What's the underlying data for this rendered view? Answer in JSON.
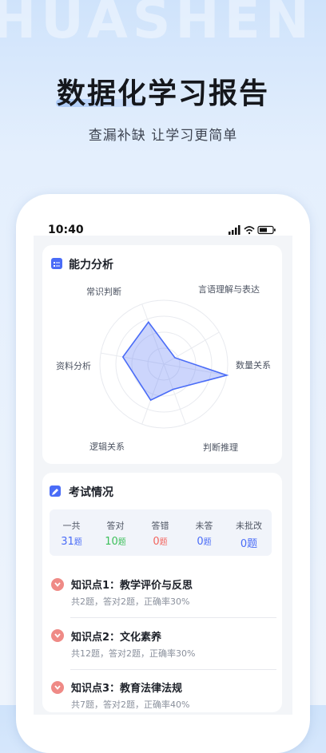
{
  "hero": {
    "bg_word": "HUASHEN",
    "title": "数据化学习报告",
    "subtitle": "查漏补缺  让学习更简单"
  },
  "status_bar": {
    "time": "10:40"
  },
  "ability": {
    "title": "能力分析",
    "axes": [
      "常识判断",
      "言语理解与表达",
      "数量关系",
      "判断推理",
      "逻辑关系",
      "资料分析"
    ],
    "values": [
      0.7,
      0.2,
      1.0,
      0.42,
      0.6,
      0.65
    ],
    "accent": "#4a6cf7"
  },
  "exam": {
    "title": "考试情况",
    "stats": [
      {
        "label": "一共",
        "value": "31",
        "unit": "题",
        "color": "#4a6cf7"
      },
      {
        "label": "答对",
        "value": "10",
        "unit": "题",
        "color": "#3cbf5a"
      },
      {
        "label": "答错",
        "value": "0",
        "unit": "题",
        "color": "#f2655f"
      },
      {
        "label": "未答",
        "value": "0",
        "unit": "题",
        "color": "#4a6cf7"
      },
      {
        "label": "未批改",
        "value": "0",
        "unit": "题",
        "color": "#4a6cf7"
      }
    ],
    "points": [
      {
        "title": "知识点1：教学评价与反思",
        "summary": "共2题，答对2题，正确率30%"
      },
      {
        "title": "知识点2：文化素养",
        "summary": "共12题，答对2题，正确率30%"
      },
      {
        "title": "知识点3：教育法律法规",
        "summary": "共7题，答对2题，正确率40%"
      }
    ]
  }
}
